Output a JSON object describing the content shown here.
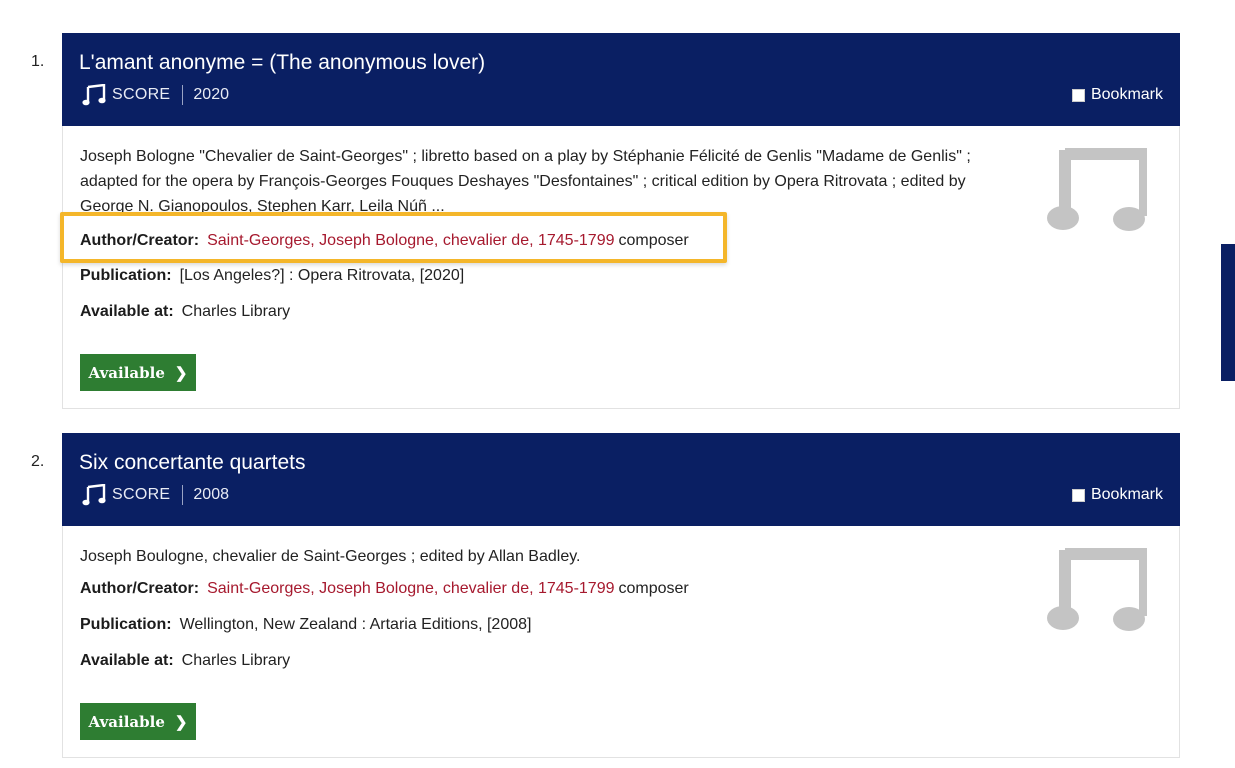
{
  "results": [
    {
      "number": "1.",
      "title": "L'amant anonyme = (The anonymous lover)",
      "format": "SCORE",
      "year": "2020",
      "bookmark_label": "Bookmark",
      "description": "Joseph Bologne \"Chevalier de Saint-Georges\" ; libretto based on a play by Stéphanie Félicité de Genlis \"Madame de Genlis\" ; adapted for the opera by François-Georges Fouques Deshayes \"Desfontaines\" ; critical edition by Opera Ritrovata ; edited by George N. Gianopoulos, Stephen Karr, Leila Núñ ...",
      "author_label": "Author/Creator:",
      "author_name": "Saint-Georges, Joseph Bologne, chevalier de, 1745-1799",
      "author_role": "composer",
      "publication_label": "Publication:",
      "publication": "[Los Angeles?] : Opera Ritrovata, [2020]",
      "available_at_label": "Available at:",
      "available_at": "Charles Library",
      "button_label": "Available",
      "thumbnail_icon": "music-note-icon"
    },
    {
      "number": "2.",
      "title": "Six concertante quartets",
      "format": "SCORE",
      "year": "2008",
      "bookmark_label": "Bookmark",
      "description": "Joseph Boulogne, chevalier de Saint-Georges ; edited by Allan Badley.",
      "author_label": "Author/Creator:",
      "author_name": "Saint-Georges, Joseph Bologne, chevalier de, 1745-1799",
      "author_role": "composer",
      "publication_label": "Publication:",
      "publication": "Wellington, New Zealand : Artaria Editions, [2008]",
      "available_at_label": "Available at:",
      "available_at": "Charles Library",
      "button_label": "Available",
      "thumbnail_icon": "music-note-icon"
    }
  ],
  "colors": {
    "header_bg": "#0a1f63",
    "author_link": "#a6192e",
    "available_button": "#2e7d32",
    "highlight_border": "#f4b62a",
    "thumbnail_gray": "#c4c4c4"
  }
}
